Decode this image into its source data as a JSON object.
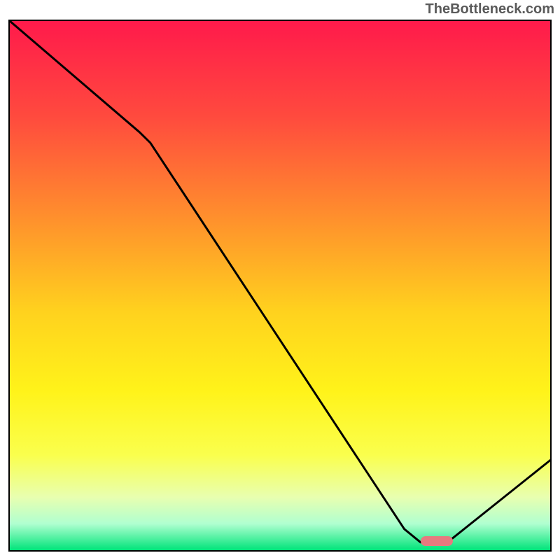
{
  "watermark": "TheBottleneck.com",
  "chart_data": {
    "type": "line",
    "x": [
      0.0,
      0.24,
      0.26,
      0.73,
      0.76,
      0.81,
      1.0
    ],
    "y": [
      1.0,
      0.79,
      0.77,
      0.04,
      0.015,
      0.015,
      0.17
    ],
    "xlim": [
      0,
      1
    ],
    "ylim": [
      0,
      1
    ],
    "title": "",
    "xlabel": "",
    "ylabel": "",
    "gradient_stops": [
      {
        "offset": 0.0,
        "color": "#ff1a4b"
      },
      {
        "offset": 0.18,
        "color": "#ff4a3e"
      },
      {
        "offset": 0.4,
        "color": "#ff9a2a"
      },
      {
        "offset": 0.55,
        "color": "#ffd21e"
      },
      {
        "offset": 0.7,
        "color": "#fff31a"
      },
      {
        "offset": 0.82,
        "color": "#faff4d"
      },
      {
        "offset": 0.9,
        "color": "#e8ffb0"
      },
      {
        "offset": 0.95,
        "color": "#b0ffd0"
      },
      {
        "offset": 1.0,
        "color": "#00e47a"
      }
    ],
    "marker": {
      "x_start": 0.76,
      "x_end": 0.82,
      "y": 0.017,
      "color": "#e77a7f"
    }
  }
}
